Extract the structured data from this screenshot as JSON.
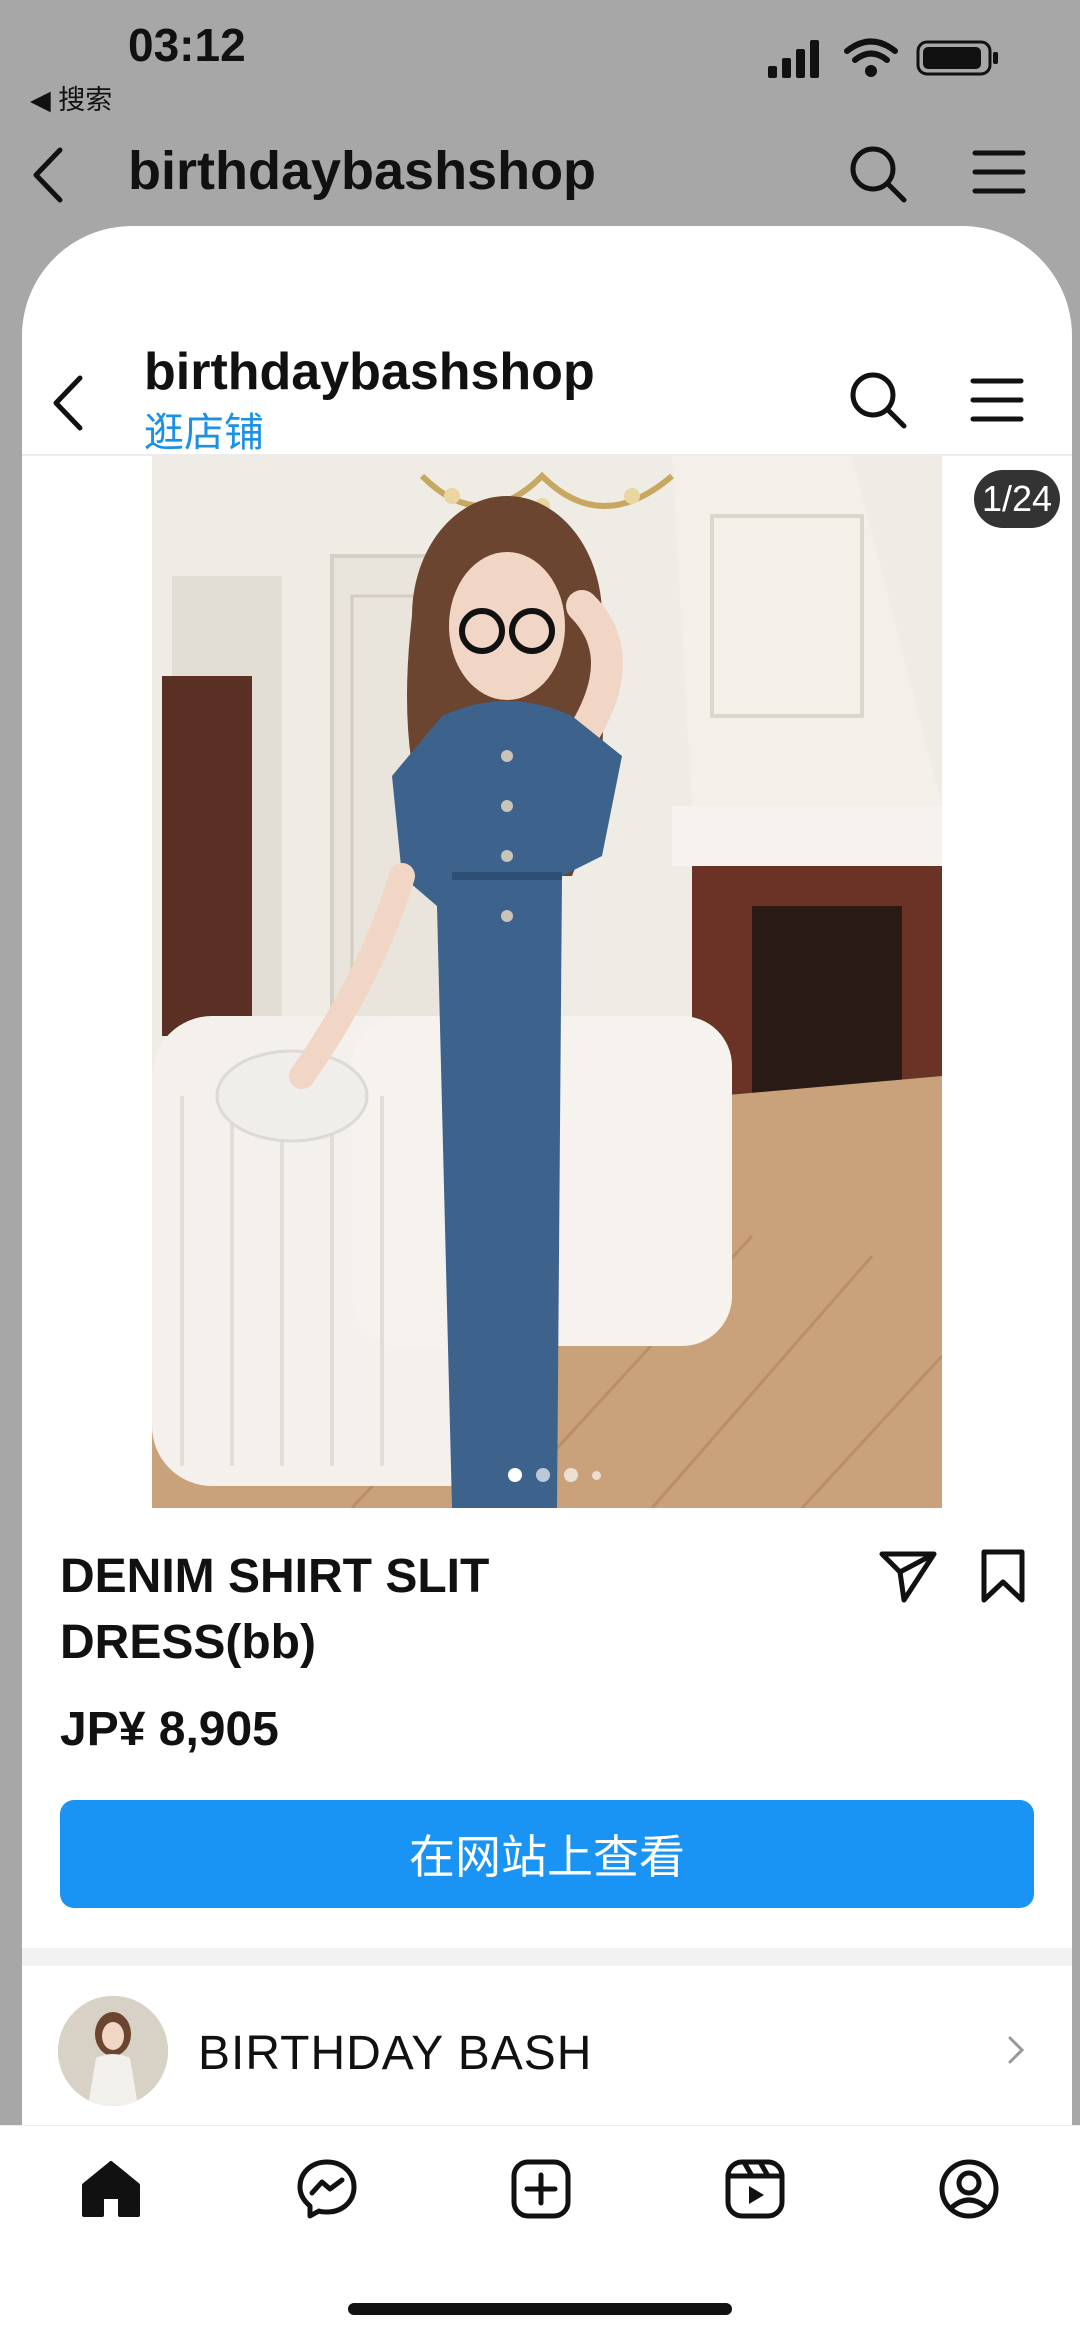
{
  "status_bar": {
    "time": "03:12",
    "back_label": "◀ 搜索"
  },
  "bg_header": {
    "title": "birthdaybashshop"
  },
  "sheet_header": {
    "shop_name": "birthdaybashshop",
    "subtitle": "逛店铺"
  },
  "product": {
    "image_counter": "1/24",
    "title_line1": "DENIM SHIRT SLIT",
    "title_line2": "DRESS(bb)",
    "price": "JP¥ 8,905",
    "cta_label": "在网站上查看"
  },
  "brand": {
    "name": "BIRTHDAY BASH"
  },
  "colors": {
    "accent": "#1a94f4",
    "link": "#1a91e6"
  },
  "bottom_nav": {
    "items": [
      "home-icon",
      "messenger-icon",
      "create-icon",
      "reels-icon",
      "profile-icon"
    ]
  }
}
